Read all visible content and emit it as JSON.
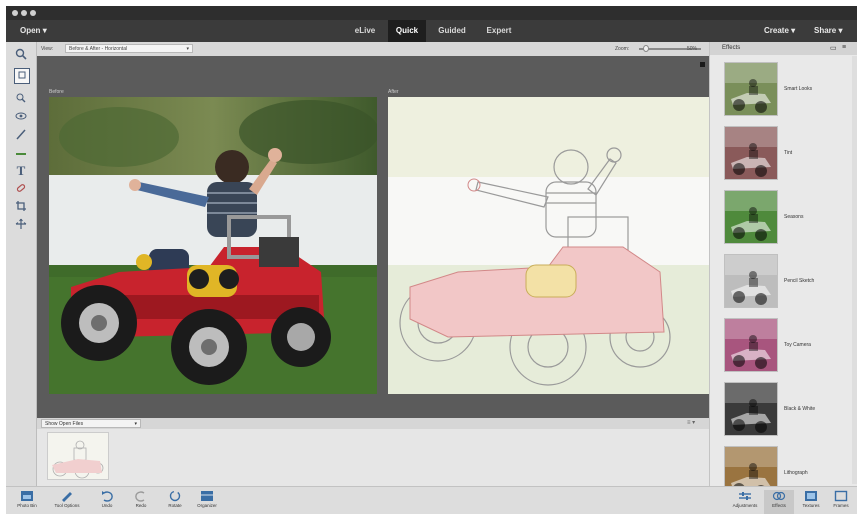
{
  "menu": {
    "open": "Open",
    "modes": [
      "eLive",
      "Quick",
      "Guided",
      "Expert"
    ],
    "active_mode": "Quick",
    "create": "Create",
    "share": "Share"
  },
  "options_bar": {
    "view_label": "View:",
    "view_value": "Before & After - Horizontal",
    "zoom_label": "Zoom:",
    "zoom_value": "50%"
  },
  "canvas": {
    "before_label": "Before",
    "after_label": "After"
  },
  "photo_bin": {
    "selector": "Show Open Files"
  },
  "effects_panel": {
    "title": "Effects",
    "items": [
      {
        "label": "Smart Looks",
        "tint": "#7a8f5a"
      },
      {
        "label": "Tint",
        "tint": "#8a5a5a"
      },
      {
        "label": "Seasons",
        "tint": "#4f8a3c"
      },
      {
        "label": "Pencil Sketch",
        "tint": "#bdbdbd"
      },
      {
        "label": "Toy Camera",
        "tint": "#a8557e"
      },
      {
        "label": "Black & White",
        "tint": "#3a3a3a"
      },
      {
        "label": "Lithograph",
        "tint": "#9a7440"
      }
    ]
  },
  "taskbar": {
    "left": [
      {
        "label": "Photo Bin",
        "icon": "photo-bin-icon"
      },
      {
        "label": "Tool Options",
        "icon": "tool-options-icon"
      },
      {
        "label": "Undo",
        "icon": "undo-icon"
      },
      {
        "label": "Redo",
        "icon": "redo-icon"
      },
      {
        "label": "Rotate",
        "icon": "rotate-icon"
      },
      {
        "label": "Organizer",
        "icon": "organizer-icon"
      }
    ],
    "right": [
      {
        "label": "Adjustments",
        "icon": "adjustments-icon"
      },
      {
        "label": "Effects",
        "icon": "effects-icon"
      },
      {
        "label": "Textures",
        "icon": "textures-icon"
      },
      {
        "label": "Frames",
        "icon": "frames-icon"
      }
    ]
  },
  "colors": {
    "canvas_bg": "#5b5b5b",
    "menubar_bg": "#3b3b3b",
    "active_tab_bg": "#1e1e1e",
    "accent_blue": "#3a6ea5"
  }
}
